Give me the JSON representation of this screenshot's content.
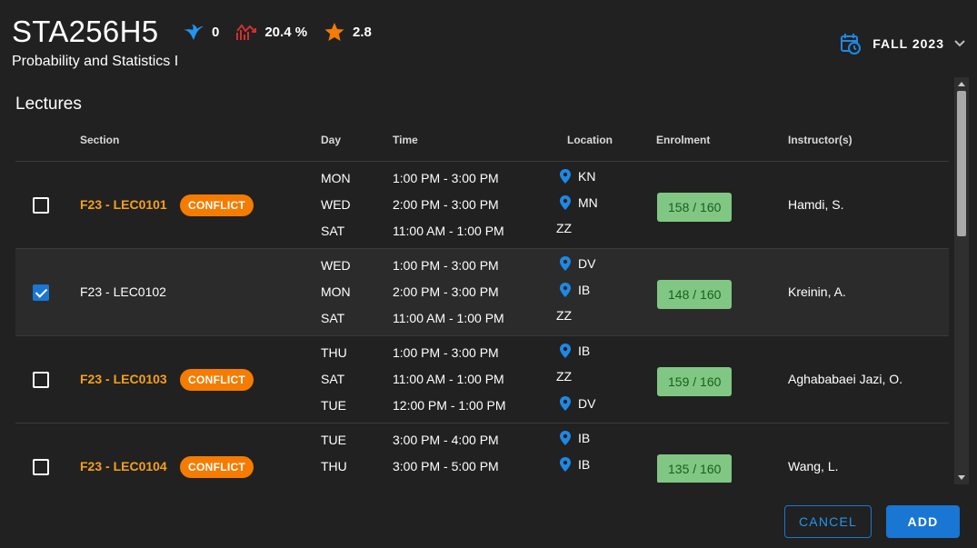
{
  "header": {
    "course_code": "STA256H5",
    "course_title": "Probability and Statistics I",
    "stats": {
      "bird_value": "0",
      "trend_value": "20.4 %",
      "rating_value": "2.8"
    },
    "term_label": "FALL 2023"
  },
  "lectures": {
    "title": "Lectures",
    "columns": {
      "section": "Section",
      "day": "Day",
      "time": "Time",
      "location": "Location",
      "enrolment": "Enrolment",
      "instructors": "Instructor(s)"
    },
    "conflict_label": "CONFLICT",
    "rows": [
      {
        "section": "F23 - LEC0101",
        "conflict": true,
        "checked": false,
        "meetings": [
          {
            "day": "MON",
            "time": "1:00 PM - 3:00 PM",
            "location": "KN"
          },
          {
            "day": "WED",
            "time": "2:00 PM - 3:00 PM",
            "location": "MN"
          },
          {
            "day": "SAT",
            "time": "11:00 AM - 1:00 PM",
            "location": "ZZ"
          }
        ],
        "enrolment": "158 / 160",
        "instructor": "Hamdi, S."
      },
      {
        "section": "F23 - LEC0102",
        "conflict": false,
        "checked": true,
        "meetings": [
          {
            "day": "WED",
            "time": "1:00 PM - 3:00 PM",
            "location": "DV"
          },
          {
            "day": "MON",
            "time": "2:00 PM - 3:00 PM",
            "location": "IB"
          },
          {
            "day": "SAT",
            "time": "11:00 AM - 1:00 PM",
            "location": "ZZ"
          }
        ],
        "enrolment": "148 / 160",
        "instructor": "Kreinin, A."
      },
      {
        "section": "F23 - LEC0103",
        "conflict": true,
        "checked": false,
        "meetings": [
          {
            "day": "THU",
            "time": "1:00 PM - 3:00 PM",
            "location": "IB"
          },
          {
            "day": "SAT",
            "time": "11:00 AM - 1:00 PM",
            "location": "ZZ"
          },
          {
            "day": "TUE",
            "time": "12:00 PM - 1:00 PM",
            "location": "DV"
          }
        ],
        "enrolment": "159 / 160",
        "instructor": "Aghababaei Jazi, O."
      },
      {
        "section": "F23 - LEC0104",
        "conflict": true,
        "checked": false,
        "meetings": [
          {
            "day": "TUE",
            "time": "3:00 PM - 4:00 PM",
            "location": "IB"
          },
          {
            "day": "THU",
            "time": "3:00 PM - 5:00 PM",
            "location": "IB"
          }
        ],
        "enrolment": "135 / 160",
        "instructor": "Wang, L."
      }
    ]
  },
  "actions": {
    "cancel_label": "CANCEL",
    "add_label": "ADD"
  },
  "colors": {
    "background": "#212121",
    "accent": "#1976d2",
    "conflict_badge": "#f57c00",
    "conflict_text": "#f5a01a",
    "enrolment_bg": "#81c784",
    "enrolment_text": "#1b5e20",
    "bird_icon": "#2196f3",
    "trend_icon": "#d32f2f",
    "star_icon": "#f57c00",
    "pin_icon": "#1e88e5"
  },
  "icons": {
    "bird": "bird-icon",
    "trend": "trend-icon",
    "star": "star-icon",
    "calendar": "calendar-clock-icon",
    "dropdown": "chevron-down-icon",
    "location": "location-pin-icon"
  }
}
